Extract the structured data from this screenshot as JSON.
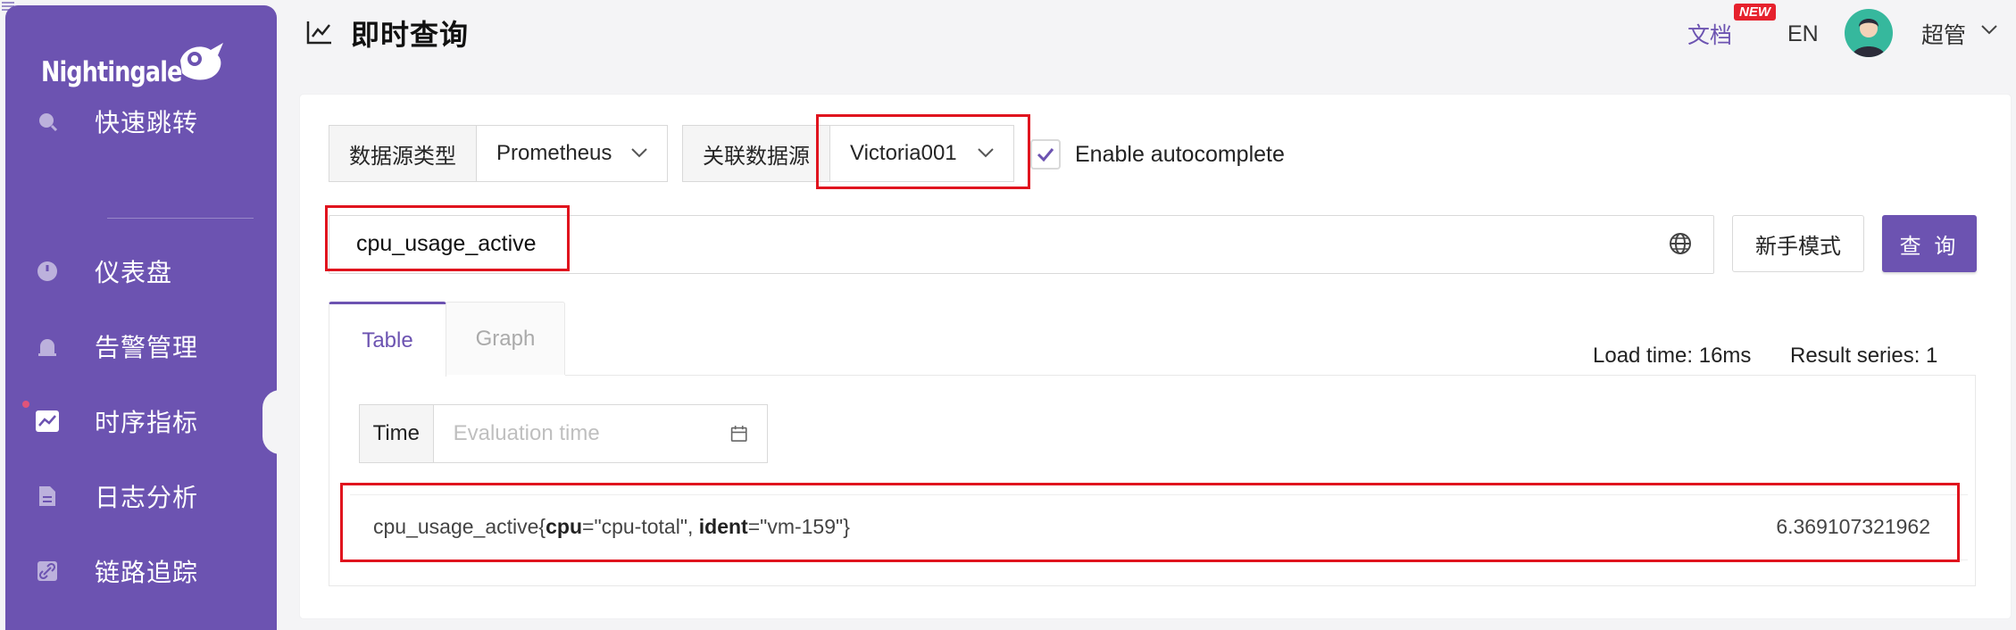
{
  "app": {
    "logo_text": "Nightingale"
  },
  "sidebar": {
    "items": [
      {
        "label": "快速跳转",
        "icon": "search-icon"
      },
      {
        "label": "仪表盘",
        "icon": "dashboard-icon"
      },
      {
        "label": "告警管理",
        "icon": "alarm-icon"
      },
      {
        "label": "时序指标",
        "icon": "line-chart-icon",
        "active": true
      },
      {
        "label": "日志分析",
        "icon": "document-icon"
      },
      {
        "label": "链路追踪",
        "icon": "link-icon"
      }
    ]
  },
  "header": {
    "title": "即时查询",
    "docs_label": "文档",
    "new_badge": "NEW",
    "lang": "EN",
    "user_name": "超管"
  },
  "query_bar": {
    "datasource_type_label": "数据源类型",
    "datasource_type_value": "Prometheus",
    "datasource_label": "关联数据源",
    "datasource_value": "Victoria001",
    "autocomplete_label": "Enable autocomplete",
    "autocomplete_checked": true,
    "query": "cpu_usage_active",
    "novice_mode_label": "新手模式",
    "query_button_label": "查 询"
  },
  "tabs": [
    {
      "label": "Table",
      "active": true
    },
    {
      "label": "Graph",
      "active": false
    }
  ],
  "stats": {
    "load_time": "Load time: 16ms",
    "result_series": "Result series: 1"
  },
  "time_filter": {
    "label": "Time",
    "placeholder": "Evaluation time"
  },
  "results": [
    {
      "metric": "cpu_usage_active",
      "labels": [
        {
          "key": "cpu",
          "value": "\"cpu-total\""
        },
        {
          "key": "ident",
          "value": "\"vm-159\""
        }
      ],
      "value": "6.369107321962"
    }
  ],
  "colors": {
    "brand": "#6c53b1",
    "highlight": "#e0141e",
    "badge": "#e6212d"
  }
}
